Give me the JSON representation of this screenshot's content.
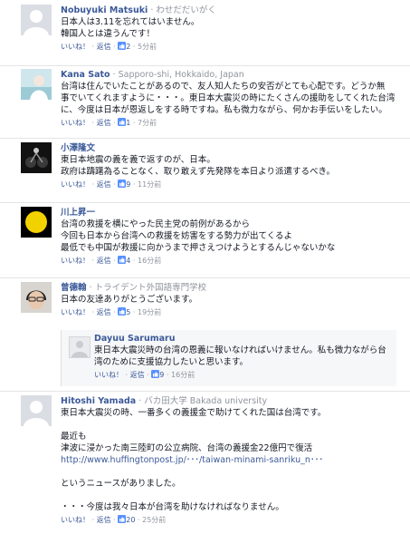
{
  "comments": [
    {
      "name": "Nobuyuki Matsuki",
      "affiliation": "· わせだだいがく",
      "lines": [
        "日本人は3.11を忘れてはいません。",
        "韓国人とは違うんです！"
      ],
      "actions": {
        "like": "いいね！",
        "reply": "返信",
        "likes": "2",
        "time": "5分前"
      }
    },
    {
      "name": "Kana Sato",
      "affiliation": "· Sapporo-shi, Hokkaido, Japan",
      "lines": [
        "台湾は住んでいたことがあるので、友人知人たちの安否がとても心配です。どうか無",
        "事でいてくれますように・・・。東日本大震災の時にたくさんの援助をしてくれた台湾",
        "に、今度は日本が恩返しをする時ですね。私も微力ながら、何かお手伝いをしたい。"
      ],
      "actions": {
        "like": "いいね！",
        "reply": "返信",
        "likes": "1",
        "time": "7分前"
      }
    },
    {
      "name": "小澤隆文",
      "affiliation": "",
      "lines": [
        "東日本地震の義を義で返すのが、日本。",
        "政府は躊躇為ることなく、取り敢えず先発隊を本日より派遣するべき。"
      ],
      "actions": {
        "like": "いいね！",
        "reply": "返信",
        "likes": "9",
        "time": "11分前"
      }
    },
    {
      "name": "川上昇一",
      "affiliation": "",
      "lines": [
        "台湾の救援を横にやった民主党の前例があるから",
        "今回も日本から台湾への救援を妨害をする勢力が出てくるよ",
        "最低でも中国が救援に向かうまで押さえつけようとするんじゃないかな"
      ],
      "actions": {
        "like": "いいね！",
        "reply": "返信",
        "likes": "4",
        "time": "16分前"
      }
    },
    {
      "name": "曾德翰",
      "affiliation": "· トライデント外国語専門学校",
      "lines": [
        "日本の友達ありがとうございます。"
      ],
      "actions": {
        "like": "いいね！",
        "reply": "返信",
        "likes": "5",
        "time": "19分前"
      }
    },
    {
      "name": "Hitoshi Yamada",
      "affiliation": "· バカ田大学 Bakada university",
      "lines": [
        "東日本大震災の時、一番多くの義援金で助けてくれた国は台湾です。",
        "",
        "最近も",
        "津波に浸かった南三陸町の公立病院、台湾の義援金22億円で復活",
        "",
        "",
        "というニュースがありました。",
        "",
        "・・・今度は我々日本が台湾を助けなければなりません。"
      ],
      "url": "http://www.huffingtonpost.jp/･･･/taiwan-minami-sanriku_n･･･",
      "actions": {
        "like": "いいね！",
        "reply": "返信",
        "likes": "20",
        "time": "25分前"
      }
    }
  ],
  "reply": {
    "name": "Dayuu Sarumaru",
    "lines": [
      "東日本大震災時の台湾の恩義に報いなければいけません。私も微力ながら台",
      "湾のために支援協力したいと思います。"
    ],
    "actions": {
      "like": "いいね！",
      "reply": "返信",
      "likes": "9",
      "time": "16分前"
    }
  },
  "colors": {
    "link": "#3b5998",
    "muted": "#90949c",
    "text": "#141823"
  }
}
